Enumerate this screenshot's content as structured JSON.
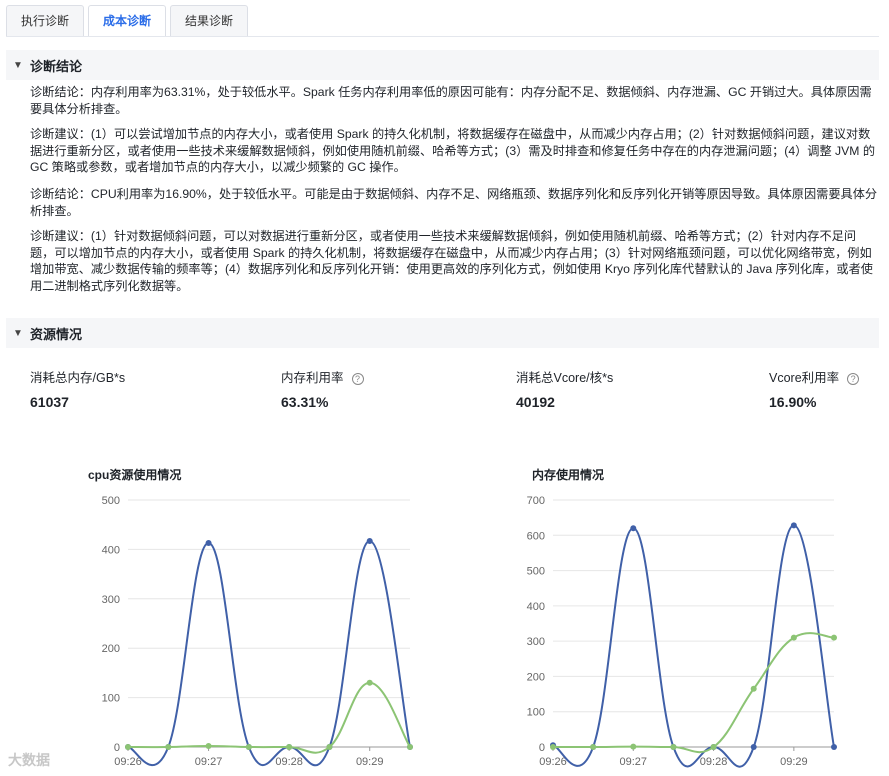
{
  "tabs": [
    {
      "label": "执行诊断"
    },
    {
      "label": "成本诊断"
    },
    {
      "label": "结果诊断"
    }
  ],
  "diagnosis": {
    "title": "诊断结论",
    "paragraphs": [
      "诊断结论：内存利用率为63.31%，处于较低水平。Spark 任务内存利用率低的原因可能有：内存分配不足、数据倾斜、内存泄漏、GC 开销过大。具体原因需要具体分析排查。",
      "诊断建议：(1）可以尝试增加节点的内存大小，或者使用 Spark 的持久化机制，将数据缓存在磁盘中，从而减少内存占用；(2）针对数据倾斜问题，建议对数据进行重新分区，或者使用一些技术来缓解数据倾斜，例如使用随机前缀、哈希等方式；(3）需及时排查和修复任务中存在的内存泄漏问题；(4）调整 JVM 的 GC 策略或参数，或者增加节点的内存大小，以减少频繁的 GC 操作。",
      "诊断结论：CPU利用率为16.90%，处于较低水平。可能是由于数据倾斜、内存不足、网络瓶颈、数据序列化和反序列化开销等原因导致。具体原因需要具体分析排查。",
      "诊断建议：(1）针对数据倾斜问题，可以对数据进行重新分区，或者使用一些技术来缓解数据倾斜，例如使用随机前缀、哈希等方式；(2）针对内存不足问题，可以增加节点的内存大小，或者使用 Spark 的持久化机制，将数据缓存在磁盘中，从而减少内存占用；(3）针对网络瓶颈问题，可以优化网络带宽，例如增加带宽、减少数据传输的频率等；(4）数据序列化和反序列化开销：使用更高效的序列化方式，例如使用 Kryo 序列化库代替默认的 Java 序列化库，或者使用二进制格式序列化数据等。"
    ]
  },
  "resources": {
    "title": "资源情况",
    "metrics": [
      {
        "label": "消耗总内存/GB*s",
        "value": "61037",
        "help": false
      },
      {
        "label": "内存利用率",
        "value": "63.31%",
        "help": true
      },
      {
        "label": "消耗总Vcore/核*s",
        "value": "40192",
        "help": false
      },
      {
        "label": "Vcore利用率",
        "value": "16.90%",
        "help": true
      }
    ]
  },
  "icons": {
    "collapse": "chevron-down-icon",
    "help": "question-circle-icon"
  },
  "colors": {
    "accent": "#2b6de8",
    "series_blue": "#4060a8",
    "series_green": "#8cc474"
  },
  "chart_data": [
    {
      "type": "line",
      "title": "cpu资源使用情况",
      "x": [
        0,
        1,
        2,
        3,
        4,
        5,
        6
      ],
      "x_tick_labels": [
        "09:26",
        "09:27",
        "09:28",
        "09:29"
      ],
      "ylim": [
        0,
        500
      ],
      "yticks": [
        "0",
        "100",
        "200",
        "300",
        "400",
        "500"
      ],
      "series": [
        {
          "values": [
            0,
            0,
            413,
            0,
            0,
            0,
            417,
            0
          ],
          "x": [
            0,
            1,
            2,
            3,
            4,
            5,
            6,
            7
          ]
        },
        {
          "values": [
            0,
            0,
            2,
            0,
            0,
            0,
            130,
            0
          ],
          "x": [
            0,
            1,
            2,
            3,
            4,
            5,
            6,
            7
          ]
        }
      ]
    },
    {
      "type": "line",
      "title": "内存使用情况",
      "x_tick_labels": [
        "09:26",
        "09:27",
        "09:28",
        "09:29"
      ],
      "ylim": [
        0,
        700
      ],
      "yticks": [
        "0",
        "100",
        "200",
        "300",
        "400",
        "500",
        "600",
        "700"
      ],
      "series": [
        {
          "values": [
            5,
            0,
            620,
            0,
            0,
            0,
            628,
            0
          ],
          "x": [
            0,
            1,
            2,
            3,
            4,
            5,
            6,
            7
          ]
        },
        {
          "values": [
            0,
            0,
            1,
            0,
            0,
            165,
            310,
            310
          ],
          "x": [
            0,
            1,
            2,
            3,
            4,
            5,
            6,
            7
          ]
        }
      ]
    }
  ],
  "footer": {
    "brand": "大数据"
  }
}
